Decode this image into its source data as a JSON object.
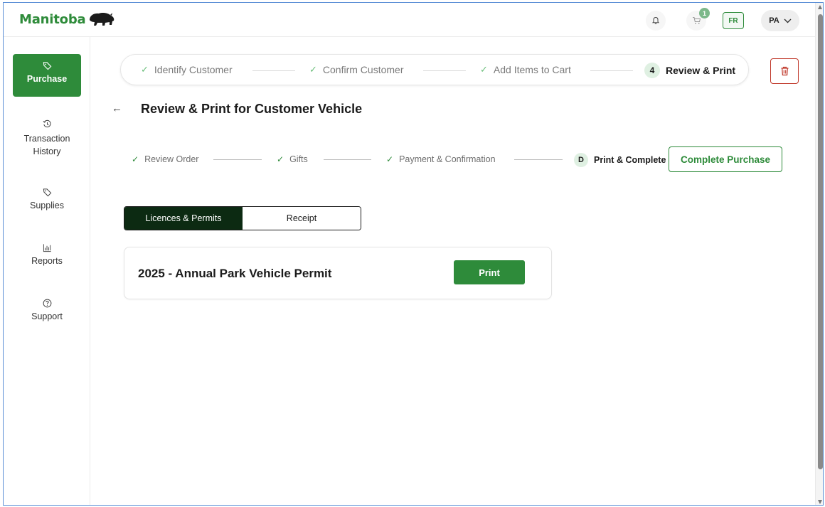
{
  "brand": {
    "name": "Manitoba",
    "color": "#2e8b3a"
  },
  "topbar": {
    "notifications_icon": "bell-icon",
    "cart_icon": "cart-icon",
    "cart_count": "1",
    "language_label": "FR",
    "user_initials": "PA"
  },
  "sidebar": {
    "items": [
      {
        "label": "Purchase",
        "icon": "tag-icon",
        "active": true
      },
      {
        "label": "Transaction History",
        "icon": "history-icon",
        "active": false
      },
      {
        "label": "Supplies",
        "icon": "tag-icon",
        "active": false
      },
      {
        "label": "Reports",
        "icon": "bar-chart-icon",
        "active": false
      },
      {
        "label": "Support",
        "icon": "help-icon",
        "active": false
      }
    ]
  },
  "main_stepper": {
    "steps": [
      {
        "label": "Identify Customer",
        "status": "done"
      },
      {
        "label": "Confirm Customer",
        "status": "done"
      },
      {
        "label": "Add Items to Cart",
        "status": "done"
      },
      {
        "number": "4",
        "label": "Review & Print",
        "status": "current"
      }
    ]
  },
  "page": {
    "title": "Review & Print for Customer Vehicle"
  },
  "sub_stepper": {
    "steps": [
      {
        "label": "Review Order",
        "status": "done"
      },
      {
        "label": "Gifts",
        "status": "done"
      },
      {
        "label": "Payment & Confirmation",
        "status": "done"
      },
      {
        "letter": "D",
        "label": "Print & Complete",
        "status": "current"
      }
    ],
    "complete_button": "Complete Purchase"
  },
  "tabs": [
    {
      "label": "Licences & Permits",
      "active": true
    },
    {
      "label": "Receipt",
      "active": false
    }
  ],
  "items": [
    {
      "title": "2025 - Annual Park Vehicle Permit",
      "action": "Print"
    }
  ],
  "colors": {
    "accent_green": "#2e8b3a",
    "dark_tab": "#0c2a12",
    "danger": "#c0392b",
    "light_green": "#dff0e2"
  }
}
